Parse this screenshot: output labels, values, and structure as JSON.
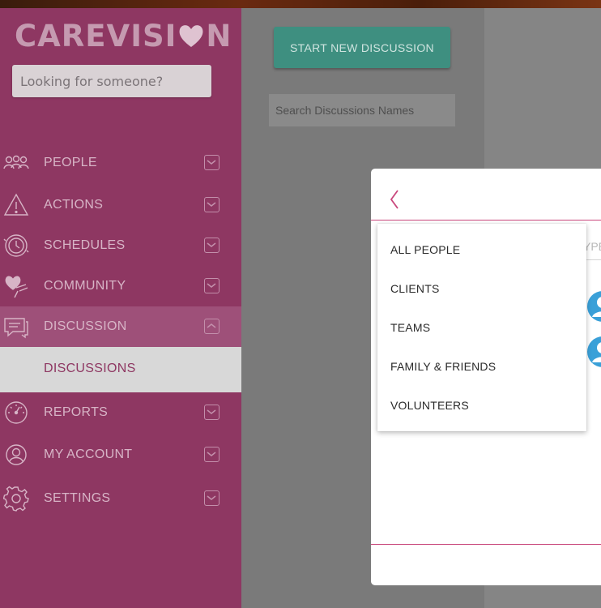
{
  "brand": {
    "logo_prefix": "CAREVISI",
    "logo_suffix": "N"
  },
  "sidebar": {
    "search_placeholder": "Looking for someone?",
    "items": [
      {
        "label": "PEOPLE",
        "icon": "people-icon"
      },
      {
        "label": "ACTIONS",
        "icon": "warning-icon"
      },
      {
        "label": "SCHEDULES",
        "icon": "clock-icon"
      },
      {
        "label": "COMMUNITY",
        "icon": "heart-hand-icon"
      },
      {
        "label": "DISCUSSION",
        "icon": "chat-icon"
      },
      {
        "label": "REPORTS",
        "icon": "gauge-icon"
      },
      {
        "label": "MY ACCOUNT",
        "icon": "user-icon"
      },
      {
        "label": "SETTINGS",
        "icon": "gear-icon"
      }
    ],
    "sub_item": "DISCUSSIONS"
  },
  "content": {
    "start_button": "START NEW DISCUSSION",
    "search_placeholder": "Search Discussions Names"
  },
  "modal": {
    "type_field_fragment": "YPE",
    "filter_options": [
      "ALL PEOPLE",
      "CLIENTS",
      "TEAMS",
      "FAMILY & FRIENDS",
      "VOLUNTEERS"
    ]
  },
  "colors": {
    "sidebar": "#8e3762",
    "accent_pink": "#c9477c",
    "button_teal": "#3e8f80"
  }
}
